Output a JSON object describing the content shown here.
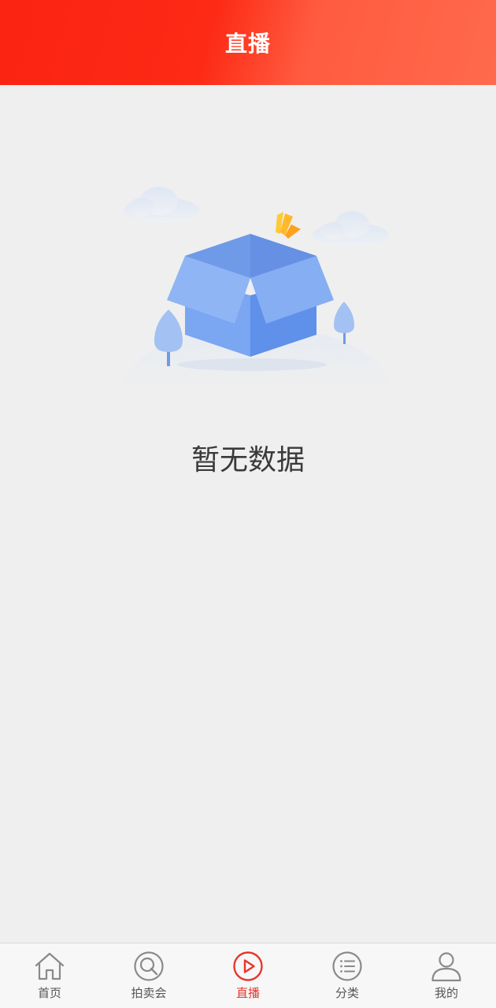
{
  "header": {
    "title": "直播"
  },
  "empty_state": {
    "message": "暂无数据",
    "illustration": "empty-box-illustration"
  },
  "tabbar": {
    "active_index": 2,
    "items": [
      {
        "label": "首页",
        "icon": "home-icon"
      },
      {
        "label": "拍卖会",
        "icon": "auction-icon"
      },
      {
        "label": "直播",
        "icon": "live-play-icon"
      },
      {
        "label": "分类",
        "icon": "category-list-icon"
      },
      {
        "label": "我的",
        "icon": "user-icon"
      }
    ]
  },
  "colors": {
    "header_red": "#fb2313",
    "header_orange": "#ff6a4c",
    "active_tab": "#e8362a",
    "inactive_tab": "#8a8a8a",
    "background": "#efefef"
  }
}
